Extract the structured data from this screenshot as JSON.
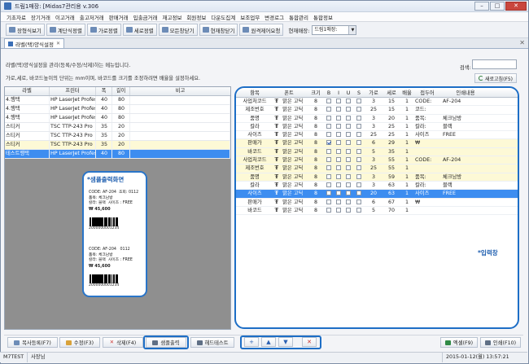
{
  "window": {
    "title": "드림1매장: [Midas7관리용 v.306"
  },
  "menu": [
    "기초자료",
    "장기거래",
    "이고거래",
    "출고저거래",
    "판매거래",
    "입출금거래",
    "재고정보",
    "회원정보",
    "다운도집계",
    "보조업무",
    "변경로그",
    "통합관리",
    "통합정보"
  ],
  "toolbar": {
    "buttons": [
      "장형식보기",
      "계단식정렬",
      "가로정렬",
      "세로정렬",
      "모든창닫기",
      "현재창닫기",
      "원격제어요청"
    ],
    "store_label": "현재매장:",
    "store_value": "드림1매장:"
  },
  "tab": {
    "label": "라벨(택)양식설정",
    "close": "✕"
  },
  "description": {
    "line1": "라벨(택)양식설정을 관리(등록/수정/삭제)하는 메뉴입니다.",
    "line2": "가로,세로, 바코드높이의 단위는 mm이며, 바코드를 크기를 조정하려면 배율을 설정하세요."
  },
  "search": {
    "label": "검색:",
    "refresh_label": "새로고침(F5)"
  },
  "left_grid": {
    "headers": [
      "라벨",
      "프린터",
      "폭",
      "길이",
      "비고"
    ],
    "rows": [
      {
        "label": "4.행택",
        "printer": "HP LaserJet Profes",
        "w": "40",
        "h": "80",
        "note": "",
        "state": "normal"
      },
      {
        "label": "4.행택",
        "printer": "HP LaserJet Profes",
        "w": "40",
        "h": "80",
        "note": "",
        "state": "normal"
      },
      {
        "label": "4.행택",
        "printer": "HP LaserJet Profes",
        "w": "40",
        "h": "80",
        "note": "",
        "state": "normal"
      },
      {
        "label": "스티커",
        "printer": "TSC TTP-243 Pro",
        "w": "35",
        "h": "20",
        "note": "",
        "state": "normal"
      },
      {
        "label": "스티커",
        "printer": "TSC TTP-243 Pro",
        "w": "35",
        "h": "20",
        "note": "",
        "state": "normal"
      },
      {
        "label": "스티커",
        "printer": "TSC TTP-243 Pro",
        "w": "35",
        "h": "20",
        "note": "",
        "state": "yellow"
      },
      {
        "label": "테스트행택",
        "printer": "HP LaserJet Profes",
        "w": "40",
        "h": "80",
        "note": "",
        "state": "selected"
      }
    ]
  },
  "preview": {
    "title": "*샘플출력화면",
    "label1": {
      "code": "CODE: AF-204",
      "size": "조회: 0112",
      "name": "품목: 체크남방",
      "color": "칼라: 블랙",
      "size2": "사이즈 : FREE",
      "price": "₩  45,600",
      "barcode": "2000000001234"
    },
    "label2": {
      "code": "CODE: AF-204",
      "size": "0112",
      "name": "품목: 체크남방",
      "color": "칼라: 블랙",
      "size2": "사이즈 : FREE",
      "price": "₩  45,600",
      "barcode": "2000000001234"
    }
  },
  "right_grid": {
    "headers": [
      "항목",
      "폰트",
      "크기",
      "B",
      "I",
      "U",
      "S",
      "가로",
      "세로",
      "배율",
      "접두어",
      "인쇄내용"
    ],
    "rows": [
      {
        "item": "사업처코드",
        "font": "맑은 고딕",
        "size": "8",
        "b": false,
        "x": "3",
        "y": "15",
        "scale": "1",
        "prefix": "CODE:",
        "content": "AF-204",
        "state": "normal"
      },
      {
        "item": "제조번호",
        "font": "맑은 고딕",
        "size": "8",
        "b": false,
        "x": "25",
        "y": "15",
        "scale": "1",
        "prefix": "코드:",
        "content": "",
        "state": "normal"
      },
      {
        "item": "품명",
        "font": "맑은 고딕",
        "size": "8",
        "b": false,
        "x": "3",
        "y": "20",
        "scale": "1",
        "prefix": "품목:",
        "content": "체크남방",
        "state": "normal"
      },
      {
        "item": "칼라",
        "font": "맑은 고딕",
        "size": "8",
        "b": false,
        "x": "3",
        "y": "25",
        "scale": "1",
        "prefix": "칼라:",
        "content": "블랙",
        "state": "normal"
      },
      {
        "item": "사이즈",
        "font": "맑은 고딕",
        "size": "8",
        "b": false,
        "x": "25",
        "y": "25",
        "scale": "1",
        "prefix": "사이즈",
        "content": "FREE",
        "state": "normal"
      },
      {
        "item": "판매가",
        "font": "맑은 고딕",
        "size": "8",
        "b": true,
        "x": "6",
        "y": "29",
        "scale": "1",
        "prefix": "₩",
        "content": "",
        "state": "yellow"
      },
      {
        "item": "바코드",
        "font": "맑은 고딕",
        "size": "8",
        "b": false,
        "x": "5",
        "y": "35",
        "scale": "1",
        "prefix": "",
        "content": "",
        "state": "yellow"
      },
      {
        "item": "사업처코드",
        "font": "맑은 고딕",
        "size": "8",
        "b": false,
        "x": "3",
        "y": "55",
        "scale": "1",
        "prefix": "CODE:",
        "content": "AF-204",
        "state": "yellow"
      },
      {
        "item": "제조번호",
        "font": "맑은 고딕",
        "size": "8",
        "b": false,
        "x": "25",
        "y": "55",
        "scale": "1",
        "prefix": "",
        "content": "",
        "state": "yellow"
      },
      {
        "item": "품명",
        "font": "맑은 고딕",
        "size": "8",
        "b": false,
        "x": "3",
        "y": "59",
        "scale": "1",
        "prefix": "품목:",
        "content": "체크남방",
        "state": "yellow"
      },
      {
        "item": "칼라",
        "font": "맑은 고딕",
        "size": "8",
        "b": false,
        "x": "3",
        "y": "63",
        "scale": "1",
        "prefix": "칼라:",
        "content": "블랙",
        "state": "normal"
      },
      {
        "item": "사이즈",
        "font": "맑은 고딕",
        "size": "8",
        "b": false,
        "x": "20",
        "y": "63",
        "scale": "1",
        "prefix": "사이즈",
        "content": "FREE",
        "state": "selected"
      },
      {
        "item": "판매가",
        "font": "맑은 고딕",
        "size": "8",
        "b": false,
        "x": "6",
        "y": "67",
        "scale": "1",
        "prefix": "₩",
        "content": "",
        "state": "normal"
      },
      {
        "item": "바코드",
        "font": "맑은 고딕",
        "size": "8",
        "b": false,
        "x": "5",
        "y": "70",
        "scale": "1",
        "prefix": "",
        "content": "",
        "state": "normal"
      }
    ]
  },
  "input_label": "*입력창",
  "bottom_buttons": {
    "copy": "복사등록(F7)",
    "edit": "수정(F3)",
    "delete": "삭제(F4)",
    "sample": "샘플출력",
    "headtest": "헤드테스트",
    "excel": "엑셀(F9)",
    "print": "인쇄(F10)"
  },
  "nav_buttons": [
    "+",
    "▲",
    "▼",
    "✕"
  ],
  "status": {
    "code": "M7TEST",
    "user": "사장님",
    "datetime": "2015-01-12(월) 13:57:21"
  },
  "colors": {
    "accent": "#1d6ec6",
    "selected_row": "#3d8df0",
    "highlight_row": "#fdf9d6"
  }
}
